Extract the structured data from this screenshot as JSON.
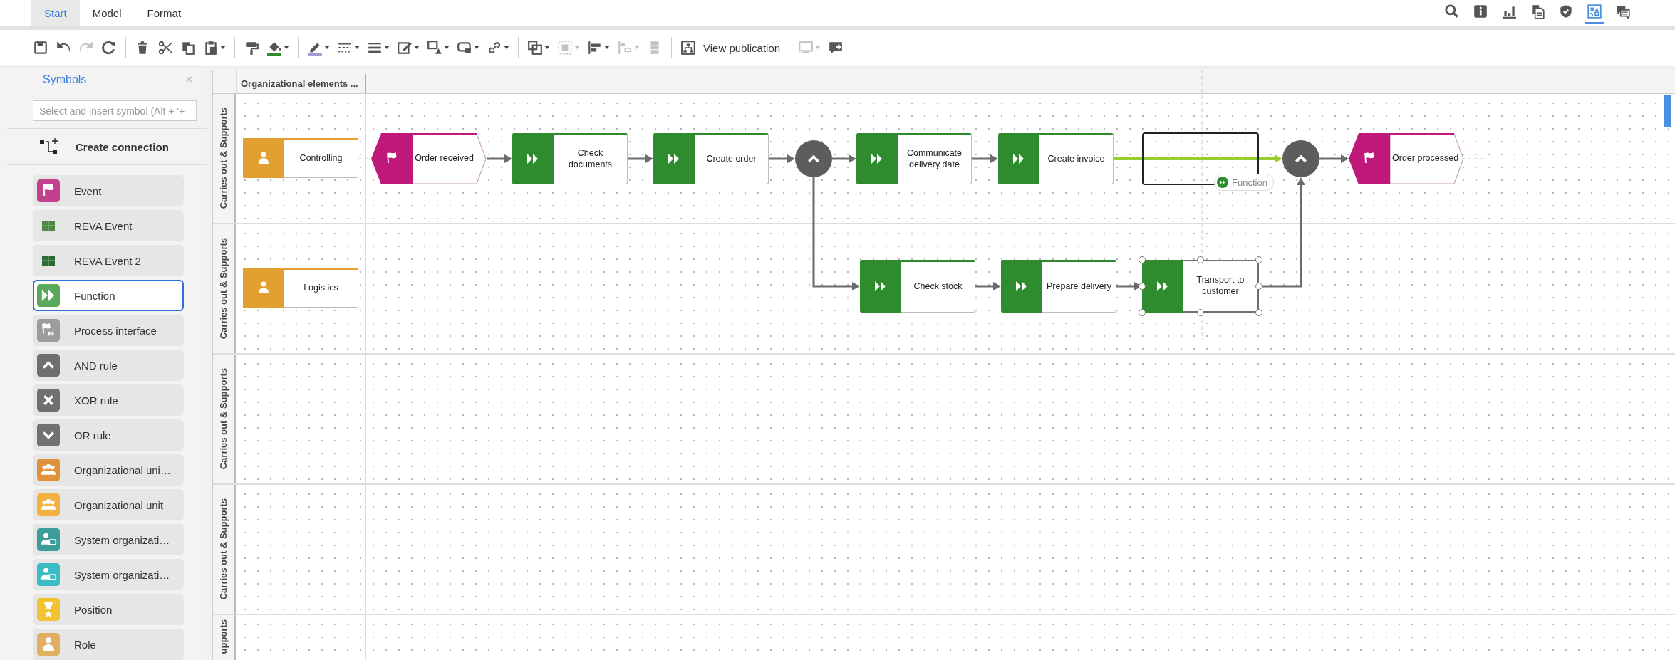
{
  "tabs": [
    {
      "label": "Start",
      "selected": true
    },
    {
      "label": "Model",
      "selected": false
    },
    {
      "label": "Format",
      "selected": false
    }
  ],
  "view_icons": [
    {
      "kind": "search",
      "selected": false
    },
    {
      "kind": "info",
      "selected": false
    },
    {
      "kind": "chart",
      "selected": false
    },
    {
      "kind": "documents",
      "selected": false
    },
    {
      "kind": "shield",
      "selected": false
    },
    {
      "kind": "symbols",
      "selected": true
    },
    {
      "kind": "comments",
      "selected": false
    }
  ],
  "toolbar": [
    [
      {
        "kind": "save",
        "menu": false,
        "disabled": false
      },
      {
        "kind": "undo",
        "menu": false,
        "disabled": false
      },
      {
        "kind": "redo",
        "menu": false,
        "disabled": true
      },
      {
        "kind": "refresh",
        "menu": false,
        "disabled": false
      }
    ],
    [
      {
        "kind": "delete",
        "menu": false,
        "disabled": false
      },
      {
        "kind": "cut",
        "menu": false,
        "disabled": false
      },
      {
        "kind": "copy",
        "menu": false,
        "disabled": false
      },
      {
        "kind": "paste",
        "menu": true,
        "disabled": false
      }
    ],
    [
      {
        "kind": "painter",
        "menu": false,
        "disabled": false
      },
      {
        "kind": "fill",
        "menu": true,
        "disabled": false
      }
    ],
    [
      {
        "kind": "linecolor",
        "menu": true,
        "disabled": false
      },
      {
        "kind": "linestyle",
        "menu": true,
        "disabled": false
      },
      {
        "kind": "lineweight",
        "menu": true,
        "disabled": false
      },
      {
        "kind": "edit",
        "menu": true,
        "disabled": false
      },
      {
        "kind": "shapes",
        "menu": true,
        "disabled": false
      },
      {
        "kind": "connector",
        "menu": true,
        "disabled": false
      },
      {
        "kind": "link",
        "menu": true,
        "disabled": false
      }
    ],
    [
      {
        "kind": "group",
        "menu": true,
        "disabled": false
      },
      {
        "kind": "frame",
        "menu": true,
        "disabled": true
      },
      {
        "kind": "align",
        "menu": true,
        "disabled": false
      },
      {
        "kind": "distribute",
        "menu": true,
        "disabled": true
      },
      {
        "kind": "stack",
        "menu": false,
        "disabled": true
      }
    ],
    [
      {
        "kind": "publication",
        "menu": false,
        "disabled": false,
        "label": "View publication"
      }
    ],
    [
      {
        "kind": "screen",
        "menu": true,
        "disabled": true
      },
      {
        "kind": "addcomment",
        "menu": false,
        "disabled": false
      }
    ]
  ],
  "sidebar": {
    "title": "Symbols",
    "close": "×",
    "search_placeholder": "Select and insert symbol (Alt + '+",
    "create_connection": "Create connection",
    "symbols": [
      {
        "kind": "event",
        "label": "Event",
        "color": "#c2418c",
        "selected": false
      },
      {
        "kind": "reva",
        "label": "REVA Event",
        "color": "#4e8a44",
        "selected": false
      },
      {
        "kind": "reva",
        "label": "REVA Event 2",
        "color": "#2c6a36",
        "selected": false
      },
      {
        "kind": "function",
        "label": "Function",
        "color": "#5aa95a",
        "selected": true
      },
      {
        "kind": "interface",
        "label": "Process interface",
        "color": "#9c9c9c",
        "selected": false
      },
      {
        "kind": "and",
        "label": "AND rule",
        "color": "#6f6f6f",
        "selected": false
      },
      {
        "kind": "xor",
        "label": "XOR rule",
        "color": "#707070",
        "selected": false
      },
      {
        "kind": "or",
        "label": "OR rule",
        "color": "#717171",
        "selected": false
      },
      {
        "kind": "org",
        "label": "Organizational uni…",
        "color": "#e0913a",
        "selected": false
      },
      {
        "kind": "org",
        "label": "Organizational unit",
        "color": "#f5b042",
        "selected": false
      },
      {
        "kind": "system",
        "label": "System organizati…",
        "color": "#3b9c9a",
        "selected": false
      },
      {
        "kind": "system",
        "label": "System organizati…",
        "color": "#3bbcc4",
        "selected": false
      },
      {
        "kind": "position",
        "label": "Position",
        "color": "#f2c230",
        "selected": false
      },
      {
        "kind": "role",
        "label": "Role",
        "color": "#e0b060",
        "selected": false
      }
    ]
  },
  "canvas": {
    "header": "Organizational elements ...",
    "lanes": [
      {
        "label": "Carries out & Supports"
      },
      {
        "label": "Carries out & Supports"
      },
      {
        "label": "Carries out & Supports"
      },
      {
        "label": "Carries out & Supports"
      },
      {
        "label": "upports"
      }
    ],
    "org_units": [
      {
        "label": "Controlling"
      },
      {
        "label": "Logistics"
      }
    ],
    "nodes": [
      {
        "kind": "event",
        "label": "Order received",
        "selected": false
      },
      {
        "kind": "function",
        "label": "Check documents",
        "selected": false
      },
      {
        "kind": "function",
        "label": "Create order",
        "selected": false
      },
      {
        "kind": "and",
        "selected": false
      },
      {
        "kind": "function",
        "label": "Communicate delivery date",
        "selected": false
      },
      {
        "kind": "function",
        "label": "Create invoice",
        "selected": false
      },
      {
        "kind": "and",
        "selected": false
      },
      {
        "kind": "event",
        "label": "Order processed",
        "selected": false
      },
      {
        "kind": "function",
        "label": "Check stock",
        "selected": false
      },
      {
        "kind": "function",
        "label": "Prepare delivery",
        "selected": false
      },
      {
        "kind": "function",
        "label": "Transport to customer",
        "selected": true
      }
    ],
    "drop_preview": {
      "label": "Function"
    }
  }
}
